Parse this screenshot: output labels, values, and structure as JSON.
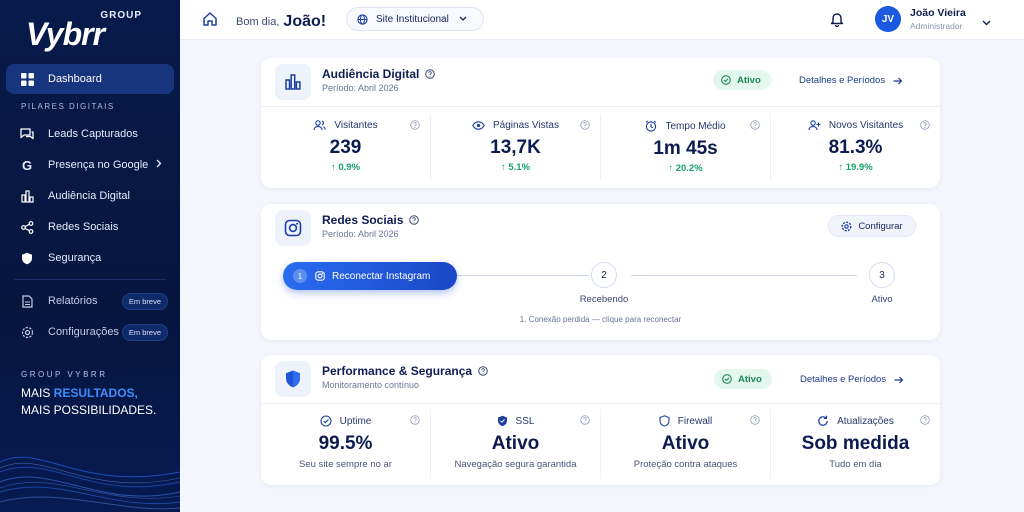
{
  "sidebar": {
    "logo_group": "GROUP",
    "logo_main": "Vybrr",
    "nav": [
      {
        "label": "Dashboard",
        "icon": "dashboard-icon",
        "active": true
      },
      {
        "label": "Leads Capturados",
        "icon": "chat-icon"
      },
      {
        "label": "Presença no Google",
        "icon": "google-icon"
      },
      {
        "label": "Audiência Digital",
        "icon": "bar-chart-icon"
      },
      {
        "label": "Redes Sociais",
        "icon": "share-icon"
      },
      {
        "label": "Segurança",
        "icon": "shield-icon"
      },
      {
        "label": "Relatórios",
        "icon": "document-icon",
        "badge": "Em breve"
      },
      {
        "label": "Configurações",
        "icon": "gear-icon",
        "badge": "Em breve"
      }
    ],
    "section_title": "PILARES DIGITAIS",
    "footer_brand": "GROUP VYBRR",
    "footer_line1_a": "MAIS ",
    "footer_line1_b": "RESULTADOS,",
    "footer_line2": "MAIS POSSIBILIDADES."
  },
  "topbar": {
    "greeting": "Bom dia,",
    "user_first": "João!",
    "site_select": "Site Institucional",
    "avatar_initials": "JV",
    "user_name": "João Vieira",
    "user_role": "Administrador"
  },
  "audiencia": {
    "title": "Audiência Digital",
    "period": "Período: Abril 2026",
    "status": "Ativo",
    "details": "Detalhes e Períodos",
    "metrics": [
      {
        "label": "Visitantes",
        "value": "239",
        "change": "0.9%"
      },
      {
        "label": "Páginas Vistas",
        "value": "13,7K",
        "change": "5.1%"
      },
      {
        "label": "Tempo Médio",
        "value": "1m 45s",
        "change": "20.2%"
      },
      {
        "label": "Novos Visitantes",
        "value": "81.3%",
        "change": "19.9%"
      }
    ]
  },
  "redes": {
    "title": "Redes Sociais",
    "period": "Período: Abril 2026",
    "config": "Configurar",
    "step1_num": "1",
    "step1_label": "Reconectar Instagram",
    "step2_num": "2",
    "step2_label": "Recebendo",
    "step3_num": "3",
    "step3_label": "Ativo",
    "note": "1. Conexão perdida — clique para reconectar"
  },
  "performance": {
    "title": "Performance & Segurança",
    "subtitle": "Monitoramento contínuo",
    "status": "Ativo",
    "details": "Detalhes e Períodos",
    "metrics": [
      {
        "label": "Uptime",
        "value": "99.5%",
        "desc": "Seu site sempre no ar"
      },
      {
        "label": "SSL",
        "value": "Ativo",
        "desc": "Navegação segura garantida"
      },
      {
        "label": "Firewall",
        "value": "Ativo",
        "desc": "Proteção contra ataques"
      },
      {
        "label": "Atualizações",
        "value": "Sob medida",
        "desc": "Tudo em dia"
      }
    ]
  },
  "colors": {
    "sidebar_bg": "#081a4a",
    "accent": "#1b5ae0",
    "success": "#16a06a"
  }
}
